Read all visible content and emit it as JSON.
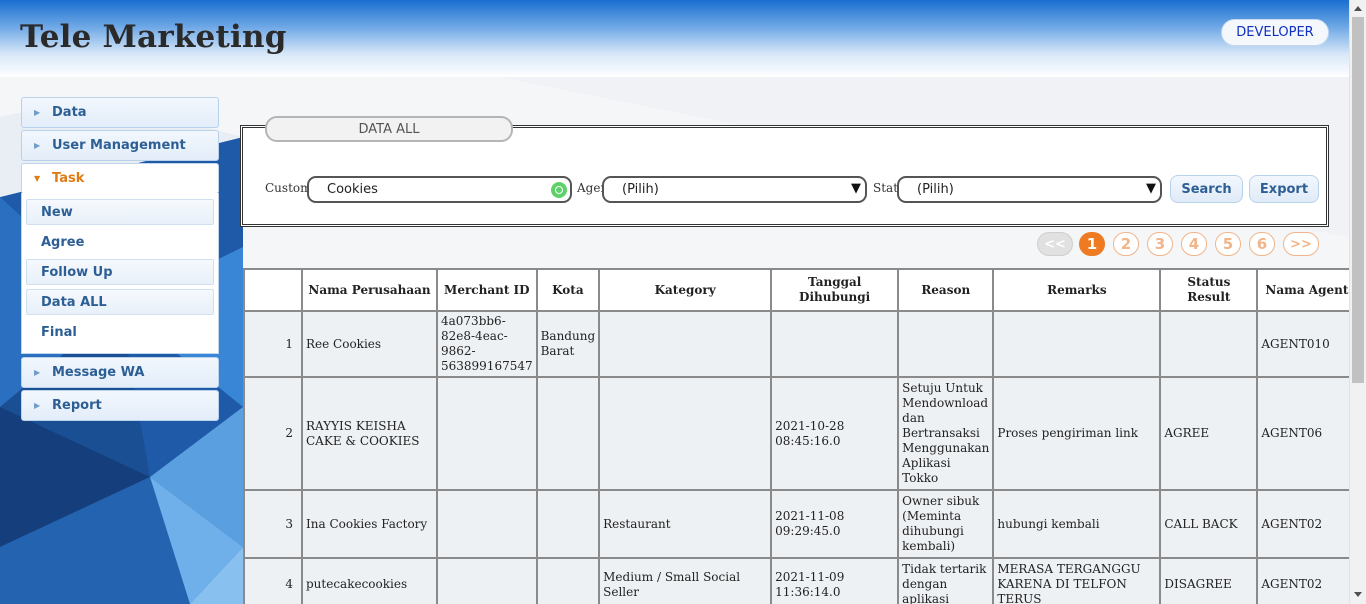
{
  "app": {
    "title": "Tele Marketing",
    "user_button": "DEVELOPER"
  },
  "sidebar": {
    "items": [
      {
        "label": "Data"
      },
      {
        "label": "User Management"
      },
      {
        "label": "Task",
        "expanded": true
      },
      {
        "label": "Message WA"
      },
      {
        "label": "Report"
      }
    ],
    "task_submenu": [
      "New",
      "Agree",
      "Follow Up",
      "Data ALL",
      "Final"
    ]
  },
  "panel": {
    "tab_title": "DATA ALL",
    "filters": {
      "customer_label": "Customer",
      "customer_value": "Cookies",
      "agent_label": "Agent",
      "agent_value": "(Pilih)",
      "status_label": "Status",
      "status_value": "(Pilih)"
    },
    "buttons": {
      "search": "Search",
      "export": "Export"
    }
  },
  "pager": {
    "prev": "<<",
    "pages": [
      "1",
      "2",
      "3",
      "4",
      "5",
      "6"
    ],
    "current": "1",
    "next": ">>"
  },
  "table": {
    "columns": [
      "",
      "Nama Perusahaan",
      "Merchant ID",
      "Kota",
      "Kategory",
      "Tanggal Dihubungi",
      "Reason",
      "Remarks",
      "Status Result",
      "Nama Agent"
    ],
    "rows": [
      [
        "1",
        "Ree Cookies",
        "4a073bb6-82e8-4eac-9862-563899167547",
        "Bandung Barat",
        "",
        "",
        "",
        "",
        "",
        "AGENT010"
      ],
      [
        "2",
        "RAYYIS KEISHA CAKE & COOKIES",
        "",
        "",
        "",
        "2021-10-28 08:45:16.0",
        "Setuju Untuk Mendownload dan Bertransaksi Menggunakan Aplikasi Tokko",
        "Proses pengiriman link",
        "AGREE",
        "AGENT06"
      ],
      [
        "3",
        "Ina Cookies Factory",
        "",
        "",
        "Restaurant",
        "2021-11-08 09:29:45.0",
        "Owner sibuk (Meminta dihubungi kembali)",
        "hubungi kembali",
        "CALL BACK",
        "AGENT02"
      ],
      [
        "4",
        "putecakecookies",
        "",
        "",
        "Medium / Small Social Seller",
        "2021-11-09 11:36:14.0",
        "Tidak tertarik dengan aplikasi",
        "MERASA TERGANGGU KARENA DI TELFON TERUS",
        "DISAGREE",
        "AGENT02"
      ]
    ]
  },
  "colors": {
    "accent": "#ee7a22",
    "link": "#2d5f95",
    "header_blue": "#1a6fd0"
  }
}
